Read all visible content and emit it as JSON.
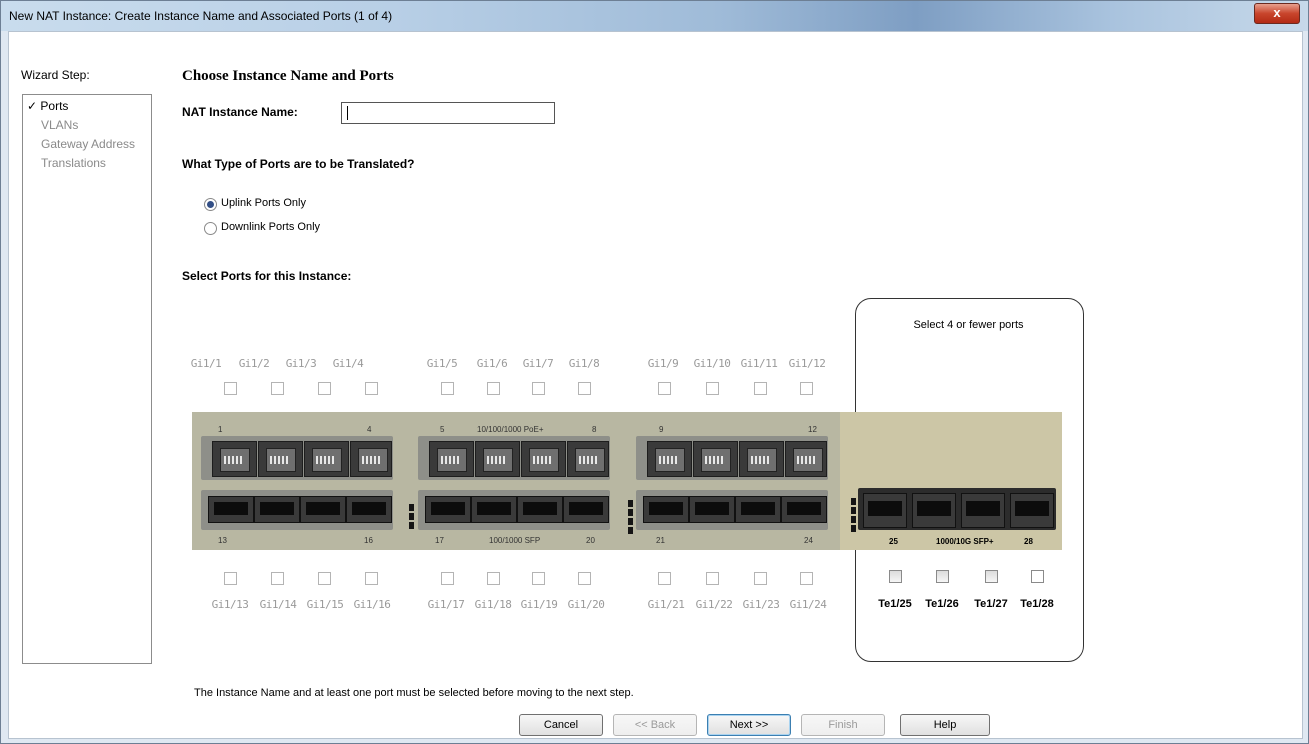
{
  "window": {
    "title": "New NAT Instance: Create Instance Name and Associated Ports (1 of 4)",
    "close_label": "x"
  },
  "wizard": {
    "label": "Wizard Step:",
    "steps": [
      {
        "label": "Ports",
        "mark": "✓",
        "active": true
      },
      {
        "label": "VLANs",
        "active": false
      },
      {
        "label": "Gateway Address",
        "active": false
      },
      {
        "label": "Translations",
        "active": false
      }
    ]
  },
  "main": {
    "heading": "Choose Instance Name and Ports",
    "name_label": "NAT Instance Name:",
    "name_value": "",
    "type_question": "What Type of Ports are to be Translated?",
    "radio_uplink": "Uplink Ports Only",
    "radio_downlink": "Downlink Ports Only",
    "radio_selected": "uplink",
    "select_label": "Select Ports for this Instance:",
    "select_hint": "Select 4 or fewer ports",
    "footer_note": "The Instance Name and at least one port must be selected before moving to the next step."
  },
  "ports": {
    "top_labels": [
      "Gi1/1",
      "Gi1/2",
      "Gi1/3",
      "Gi1/4",
      "Gi1/5",
      "Gi1/6",
      "Gi1/7",
      "Gi1/8",
      "Gi1/9",
      "Gi1/10",
      "Gi1/11",
      "Gi1/12"
    ],
    "bottom_labels": [
      "Gi1/13",
      "Gi1/14",
      "Gi1/15",
      "Gi1/16",
      "Gi1/17",
      "Gi1/18",
      "Gi1/19",
      "Gi1/20",
      "Gi1/21",
      "Gi1/22",
      "Gi1/23",
      "Gi1/24"
    ],
    "te_labels": [
      "Te1/25",
      "Te1/26",
      "Te1/27",
      "Te1/28"
    ],
    "silk": {
      "n1": "1",
      "n4": "4",
      "n5": "5",
      "poe": "10/100/1000 PoE+",
      "n8": "8",
      "n9": "9",
      "n12": "12",
      "n13": "13",
      "n16": "16",
      "n17": "17",
      "sfp": "100/1000 SFP",
      "n20": "20",
      "n21": "21",
      "n24": "24",
      "n25": "25",
      "sfpplus": "1000/10G SFP+",
      "n28": "28"
    }
  },
  "buttons": {
    "cancel": "Cancel",
    "back": "<< Back",
    "next": "Next >>",
    "finish": "Finish",
    "help": "Help"
  }
}
